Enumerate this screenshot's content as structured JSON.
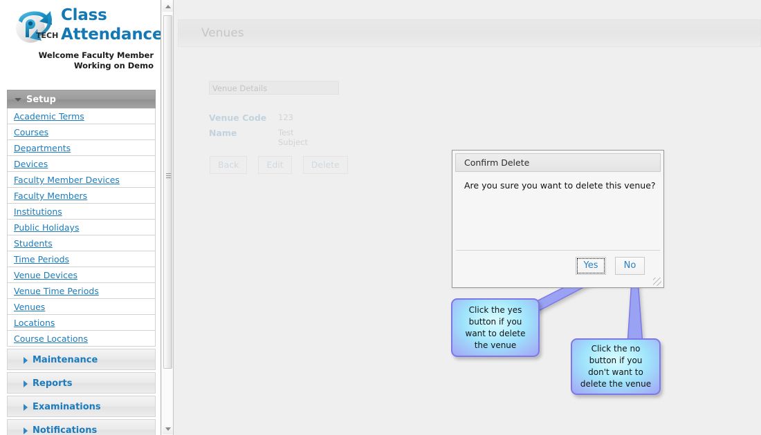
{
  "brand": {
    "logo_icon": "globe-arrow-logo",
    "logo_text": "TECH",
    "title_line1": "Class",
    "title_line2": "Attendance",
    "welcome_line1": "Welcome Faculty Member",
    "welcome_line2": "Working on Demo",
    "title_color": "#1478b4"
  },
  "sidebar": {
    "setup": {
      "label": "Setup",
      "expanded": true,
      "caret_icon": "caret-down-icon"
    },
    "links": [
      {
        "label": "Academic Terms"
      },
      {
        "label": "Courses"
      },
      {
        "label": "Departments"
      },
      {
        "label": "Devices"
      },
      {
        "label": "Faculty Member Devices"
      },
      {
        "label": "Faculty Members"
      },
      {
        "label": "Institutions"
      },
      {
        "label": "Public Holidays"
      },
      {
        "label": "Students"
      },
      {
        "label": "Time Periods"
      },
      {
        "label": "Venue Devices"
      },
      {
        "label": "Venue Time Periods"
      },
      {
        "label": "Venues"
      },
      {
        "label": "Locations"
      },
      {
        "label": "Course Locations"
      }
    ],
    "sections": [
      {
        "label": "Maintenance",
        "caret_icon": "caret-right-icon"
      },
      {
        "label": "Reports",
        "caret_icon": "caret-right-icon"
      },
      {
        "label": "Examinations",
        "caret_icon": "caret-right-icon"
      },
      {
        "label": "Notifications",
        "caret_icon": "caret-right-icon"
      }
    ],
    "link_color": "#1b7bbd"
  },
  "scrollbar": {
    "up_icon": "scroll-up-arrow-icon",
    "down_icon": "scroll-down-arrow-icon",
    "grip_icon": "scrollbar-grip-icon"
  },
  "main": {
    "page_title": "Venues",
    "details_header": "Venue Details",
    "fields": [
      {
        "label": "Venue Code",
        "value": "123"
      },
      {
        "label": "Name",
        "value": "Test Subject"
      }
    ],
    "buttons": [
      {
        "label": "Back"
      },
      {
        "label": "Edit"
      },
      {
        "label": "Delete"
      }
    ]
  },
  "dialog": {
    "title": "Confirm Delete",
    "message": "Are you sure you want to delete this venue?",
    "yes_label": "Yes",
    "no_label": "No",
    "resize_icon": "resize-grip-icon",
    "button_text_color": "#2a7fc0"
  },
  "callouts": [
    {
      "id": "callout-yes",
      "text": "Click the yes button if you want to delete the venue",
      "border_color": "#7d77e8"
    },
    {
      "id": "callout-no",
      "text": "Click the no button if you don't want to delete the venue",
      "border_color": "#7d77e8"
    }
  ]
}
